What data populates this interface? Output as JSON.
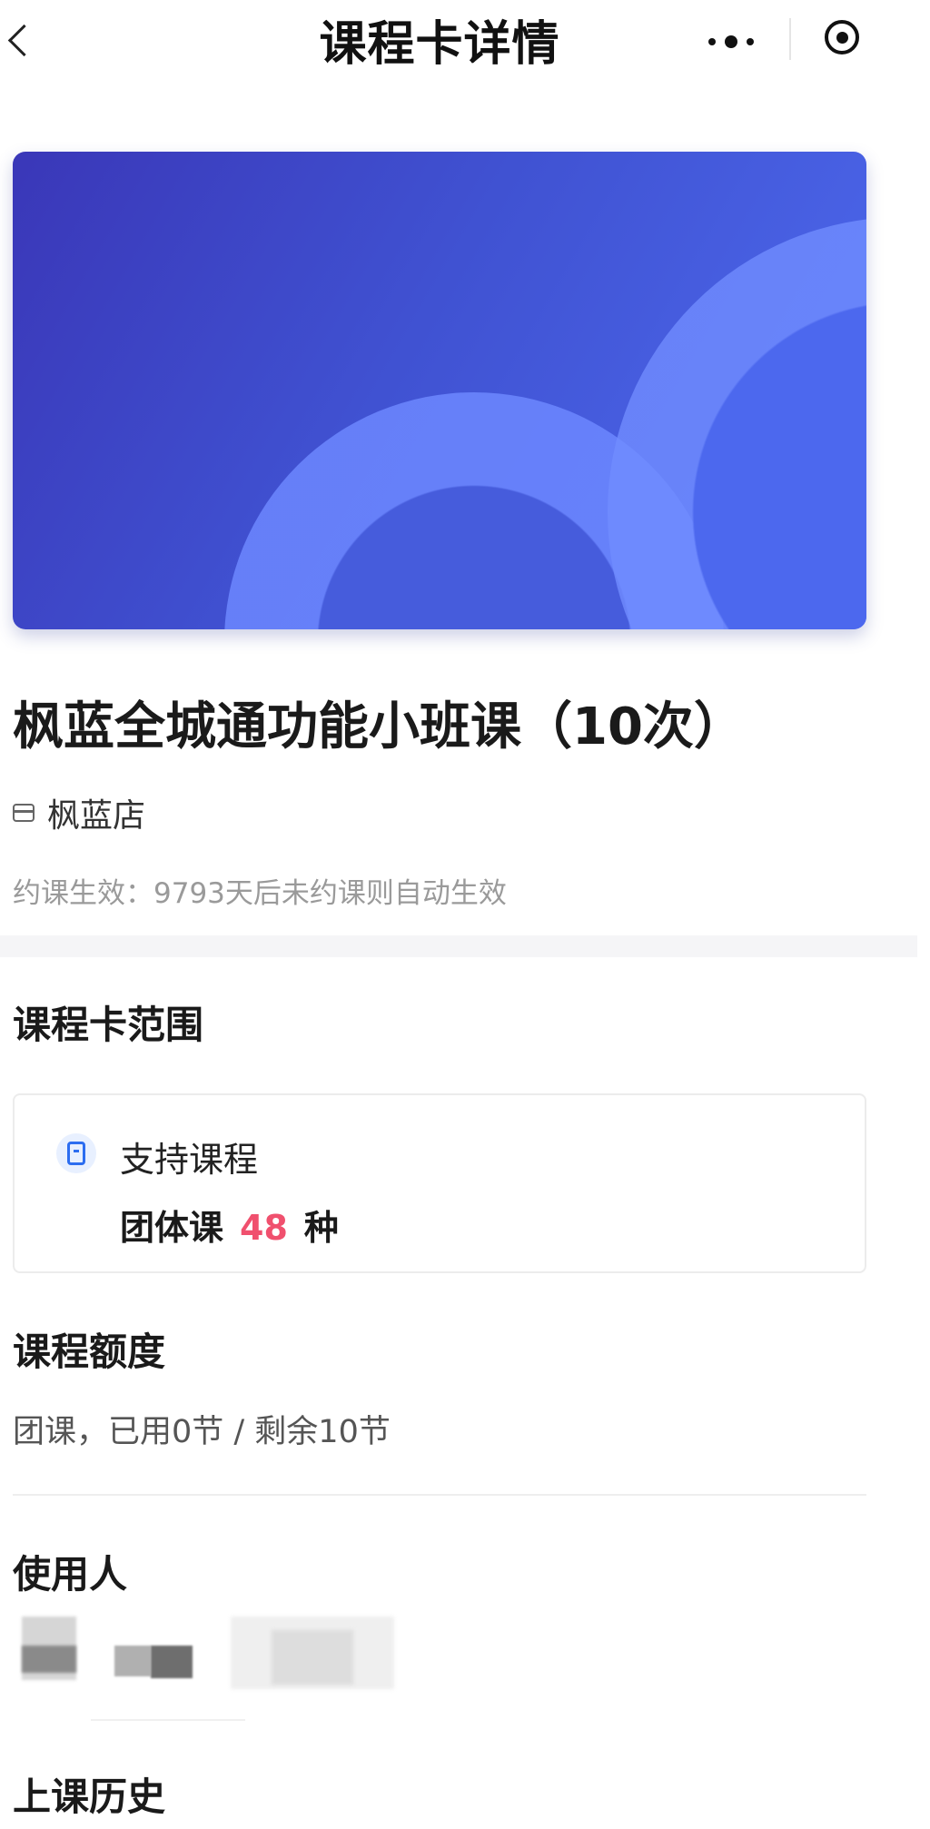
{
  "nav": {
    "title": "课程卡详情",
    "back_icon": "chevron-left-icon",
    "more_icon": "more-dots-icon",
    "capsule_icon": "target-icon"
  },
  "banner": {
    "colors": {
      "start": "#3a37b8",
      "end": "#4e6bf0",
      "ring": "#6c87ff"
    }
  },
  "card": {
    "title": "枫蓝全城通功能小班课（10次）",
    "store_icon": "store-icon",
    "store_name": "枫蓝店",
    "booking_note": "约课生效：9793天后未约课则自动生效"
  },
  "scope": {
    "heading": "课程卡范围",
    "support_icon": "course-icon",
    "support_label": "支持课程",
    "course_type": "团体课",
    "count": "48",
    "unit": "种",
    "count_color": "#f0506e"
  },
  "quota": {
    "heading": "课程额度",
    "text": "团课，已用0节 / 剩余10节"
  },
  "users": {
    "heading": "使用人"
  },
  "history": {
    "heading": "上课历史"
  }
}
